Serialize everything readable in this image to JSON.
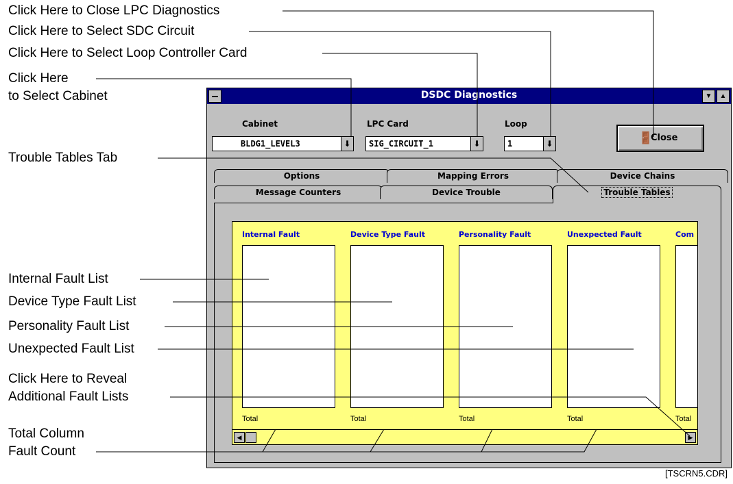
{
  "callouts": {
    "close_lpc": "Click Here to Close LPC Diagnostics",
    "select_sdc": "Click Here to Select SDC Circuit",
    "select_loop_card": "Click Here to Select Loop Controller Card",
    "select_cabinet_1": "Click Here",
    "select_cabinet_2": "to Select Cabinet",
    "trouble_tab": "Trouble Tables Tab",
    "internal_list": "Internal Fault List",
    "device_type_list": "Device Type Fault List",
    "personality_list": "Personality Fault List",
    "unexpected_list": "Unexpected Fault List",
    "reveal_1": "Click Here to Reveal",
    "reveal_2": "Additional Fault Lists",
    "total_1": "Total Column",
    "total_2": "Fault Count"
  },
  "figure_ref": "[TSCRN5.CDR]",
  "window": {
    "title": "DSDC Diagnostics",
    "cabinet_label": "Cabinet",
    "cabinet_value": "BLDG1_LEVEL3",
    "lpc_label": "LPC Card",
    "lpc_value": "SIG_CIRCUIT_1",
    "loop_label": "Loop",
    "loop_value": "1",
    "close_label": "Close"
  },
  "tabs": {
    "back": [
      "Options",
      "Mapping Errors",
      "Device Chains"
    ],
    "front": [
      "Message Counters",
      "Device Trouble",
      "Trouble Tables"
    ]
  },
  "columns": [
    "Internal Fault",
    "Device Type Fault",
    "Personality Fault",
    "Unexpected Fault",
    "Com"
  ],
  "total_label": "Total"
}
